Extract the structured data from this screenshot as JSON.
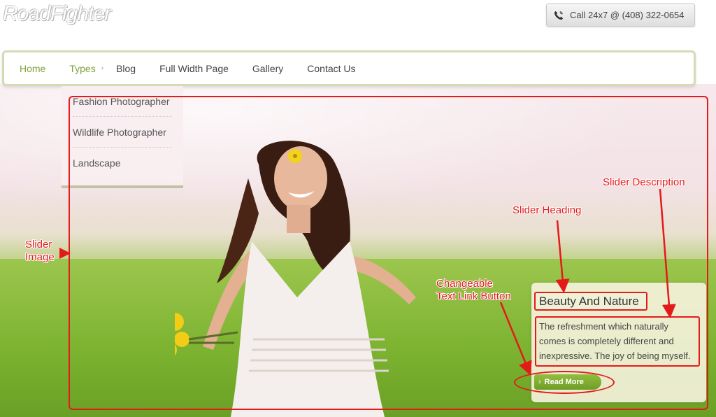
{
  "header": {
    "logo_text": "RoadFighter",
    "call_label": "Call 24x7 @ (408) 322-0654",
    "call_icon": "phone-icon"
  },
  "nav": {
    "items": [
      {
        "label": "Home"
      },
      {
        "label": "Types"
      },
      {
        "label": "Blog"
      },
      {
        "label": "Full Width Page"
      },
      {
        "label": "Gallery"
      },
      {
        "label": "Contact Us"
      }
    ],
    "active_color": "#7fa23a"
  },
  "dropdown": {
    "items": [
      "Fashion Photographer",
      "Wildlife Photographer",
      "Landscape"
    ]
  },
  "slider": {
    "heading": "Beauty And Nature",
    "description": "The refreshment which naturally comes is completely different and inexpressive. The joy of being myself.",
    "button_label": "Read More",
    "button_icon": "chevron-right-icon"
  },
  "annotations": {
    "slider_image": [
      "Slider",
      "Image"
    ],
    "slider_heading": "Slider Heading",
    "slider_description": "Slider Description",
    "link_button": [
      "Changeable",
      "Text Link Button"
    ],
    "color": "#e41a1a"
  }
}
